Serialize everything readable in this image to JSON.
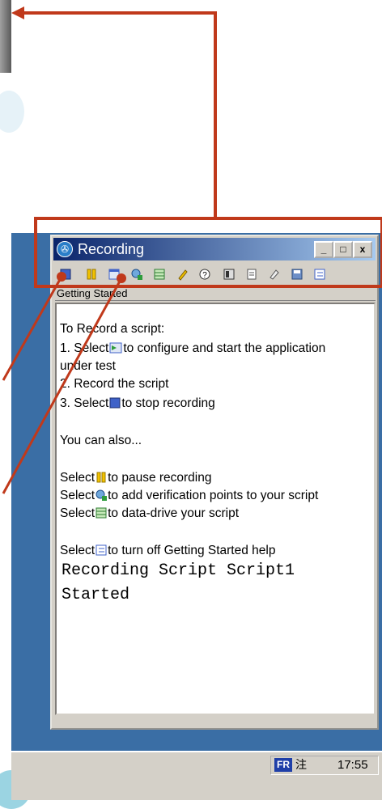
{
  "window": {
    "title": "Recording",
    "minimize_label": "_",
    "maximize_label": "□",
    "close_label": "x",
    "tab": "Getting Started"
  },
  "toolbar": {
    "buttons": [
      {
        "icon": "stop-recording-icon"
      },
      {
        "icon": "pause-recording-icon"
      },
      {
        "icon": "insert-script-support-icon"
      },
      {
        "icon": "verification-point-icon"
      },
      {
        "icon": "data-driven-commands-icon"
      },
      {
        "icon": "highlight-icon"
      },
      {
        "icon": "help-icon"
      },
      {
        "icon": "display-icon"
      },
      {
        "icon": "log-icon"
      },
      {
        "icon": "clear-icon"
      },
      {
        "icon": "save-icon"
      },
      {
        "icon": "getting-started-toggle-icon"
      }
    ]
  },
  "content": {
    "heading": "To Record a script:",
    "step1_a": "1. Select",
    "step1_b": "to configure and start the application",
    "step1_c": "under test",
    "step2": "2. Record the script",
    "step3_a": "3. Select",
    "step3_b": "to stop recording",
    "also": "You can also...",
    "pause_a": "Select",
    "pause_b": "to pause recording",
    "vp_a": "Select",
    "vp_b": "to add verification points to your script",
    "dd_a": "Select",
    "dd_b": "to data-drive your script",
    "off_a": "Select",
    "off_b": "to turn off Getting Started help",
    "log1": "Recording Script Script1",
    "log2": "Started"
  },
  "taskbar": {
    "lang": "FR",
    "ime": "注",
    "clock": "17:55"
  },
  "colors": {
    "annotation": "#c0391b",
    "desktop": "#3a6ea5",
    "titlebar_start": "#0a246a",
    "titlebar_end": "#a6caf0"
  }
}
